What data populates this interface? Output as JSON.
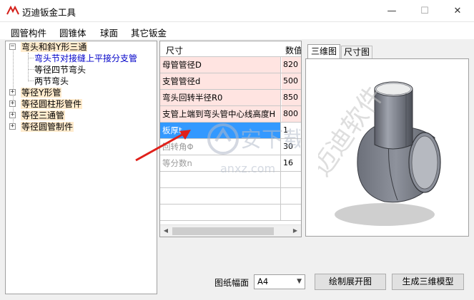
{
  "window": {
    "title": "迈迪钣金工具",
    "minimize_glyph": "—",
    "maximize_glyph": "☐",
    "close_glyph": "✕"
  },
  "menu": [
    "圆管构件",
    "圆锥体",
    "球面",
    "其它钣金"
  ],
  "tree": {
    "root": {
      "label": "弯头和斜Y形三通",
      "children": [
        "弯头节对接缝上平接分支管",
        "等径四节弯头",
        "两节弯头"
      ]
    },
    "groups": [
      "等径Y形管",
      "等径圆柱形管件",
      "等径三通管",
      "等径圆管制件"
    ]
  },
  "grid": {
    "columns": [
      "尺寸",
      "数值"
    ],
    "rows": [
      {
        "name": "母管管径D",
        "value": "820"
      },
      {
        "name": "支管管径d",
        "value": "500"
      },
      {
        "name": "弯头回转半径R0",
        "value": "850"
      },
      {
        "name": "支管上端到弯头管中心线高度H",
        "value": "800"
      },
      {
        "name": "板厚t",
        "value": "1"
      },
      {
        "name": "回转角Φ",
        "value": "30"
      },
      {
        "name": "等分数n",
        "value": "16"
      }
    ]
  },
  "tabs": [
    "三维图",
    "尺寸图"
  ],
  "bottom": {
    "paper_label": "图纸幅面",
    "paper_size": "A4",
    "unfold_button": "绘制展开图",
    "model_button": "生成三维模型"
  },
  "watermark": {
    "text": "安下载",
    "url": "anxz.com",
    "vertical_text": "迈迪软件"
  },
  "colors": {
    "highlight_row": "#ffe4e1",
    "selected_row": "#3399ff",
    "tree_highlight": "#ffebcd",
    "annotation_arrow": "#e0201a"
  }
}
